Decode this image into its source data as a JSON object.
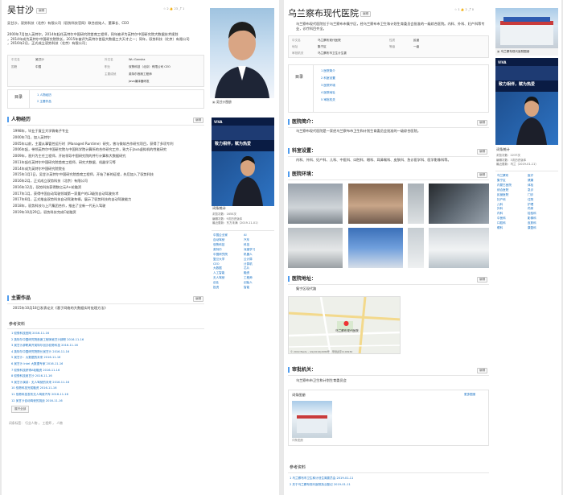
{
  "colors": {
    "link": "#136ec2",
    "accent": "#4f9cee",
    "banner": "#0a1c44",
    "hospital_blue": "#2e5bb0"
  },
  "left": {
    "title": "吴甘沙",
    "edit": "编辑",
    "stats": [
      "2",
      "23",
      "1"
    ],
    "summary": "吴甘沙，驭势科技（北京）有限公司（驭势科技官网）联合创始人、董事长、CEO",
    "intro_lines": [
      "2000年7月加入英特尔，2014年起任英特尔中国研究院首席工程师，同年被评为英特尔中国研究院大数据技术规划",
      "，2014年成为英特尔中国研究院院长，2015年被评为英特尔首届大数据三大天才之一；同年，驭势科技（北京）有限公司",
      "，2016年2月，正式成立驭势科技（北京）有限公司；"
    ],
    "basic_info": [
      [
        "中文名",
        "吴甘沙",
        "外文名",
        "Wu Gansha"
      ],
      [
        "国籍",
        "中国",
        "职业",
        "驭势科技（北京）有限公司 CEO"
      ],
      [
        "",
        "",
        "主要成就",
        "英特尔首席工程师"
      ],
      [
        "",
        "",
        "",
        "Java编译器研发"
      ]
    ],
    "toc_label": "目录",
    "toc": [
      "1 人物经历",
      "2 主要作品"
    ],
    "sec1": "人物经历",
    "bio": [
      "1998年，毕业于复旦大学微电子专业",
      "2000年7月，加入英特尔",
      "2005年以前，主要从事管控运行时（Managed Runtime）研究，曾与微软合作研究项目，获得了多项专利",
      "2006年起，带领英特尔中国研究院与中国科学院计算所的合作研究工作，致力于Java虚拟机的性能研究",
      "2009年，晋升为主任工程师，开始领导中国研究院的并行计算和大数据研究",
      "2011年起任英特尔中国研究院首席工程师，研究大数据、机器学习等",
      "2014年成为英特尔中国研究院院长",
      "2015年1月1日，吴甘沙英特尔中国研究院首席工程师，开始了新的征程，先后加入了驭势科技",
      "2016年2月，正式成立驭势科技（北京）有限公司",
      "2016年12月，驭势科技获得数亿元A+轮融资",
      "2017年1月，获得中国自动驾驶领域第一家量产的L3级别自动驾驶技术",
      "2017年8月，正式推出驭势科技自动驾驶车辆，展示了驭势科技的自动驾驶能力",
      "2018年，驭势科技与上汽集团合作，推出了全新一代无人驾驶",
      "2019年10月29日，驭势科技完成C轮融资"
    ],
    "sec2": "主要作品",
    "works": "2015年10月18日发表论文《基于网络的大数据实时处理方法》",
    "refs_title": "参考资料",
    "refs": [
      "1 驭势科技官网  2016-11-16",
      "2 英特尔中国研究院首席工程师吴甘沙辞职  2016-11-16",
      "3 吴甘沙辞职离开英特尔创办驭势科技  2016-11-16",
      "4 英特尔中国研究院院长吴甘沙  2016-11-16",
      "5 吴甘沙：大数据的未来  2016-11-16",
      "6 吴甘沙 Intel 大数据专家  2016-11-16",
      "7 驭势科技获得A轮融资  2016-11-16",
      "8 驭势科技吴甘沙  2016-11-16",
      "9 吴甘沙演讲：无人驾驶的未来  2016-11-16",
      "10 驭势科技完成融资  2016-11-16",
      "11 驭势科技发布无人驾驶汽车  2016-11-16",
      "12 吴甘沙自动驾驶的挑战  2016-11-16"
    ],
    "more_btn": "展开全部",
    "tags": "词条标签：  行业人物 ， 工程师 ， 人物",
    "photo_caption": "吴甘沙图册",
    "banner_brand": "VIVA",
    "banner_text": "致力相伴，赋为热爱",
    "stats_title": "词条统计",
    "stats_lines": [
      "浏览次数：1655次",
      "编辑次数：9次历史版本",
      "最近更新：东方未满（2019-11-01）"
    ],
    "links_col1": [
      "中国企业家",
      "自动驾驶",
      "驭势科技",
      "英特尔",
      "中国研究院",
      "复旦大学",
      "CEO",
      "大数据",
      "人工智能",
      "无人驾驶",
      "创业",
      "投资"
    ],
    "links_col2": [
      "AI",
      "汽车",
      "科技",
      "深度学习",
      "机器人",
      "云计算",
      "计算机",
      "芯片",
      "融资",
      "工程师",
      "创始人",
      "智能"
    ]
  },
  "right": {
    "title": "乌兰察布现代医院",
    "edit": "编辑",
    "stats": [
      "1",
      "2",
      "0"
    ],
    "summary": "乌兰察布现代医院位于乌兰察布市集宁区，经乌兰察布市卫生和计划生育委员会批准的一级综合医院。内科、外科、妇产科等专业，诊疗科目齐全。",
    "basic_info": [
      [
        "中文名",
        "乌兰察布现代医院",
        "性质",
        "民营"
      ],
      [
        "地址",
        "集宁区",
        "等级",
        "一级"
      ],
      [
        "审批机关",
        "乌兰察布市卫生计生委",
        "",
        ""
      ]
    ],
    "toc_label": "目录",
    "toc": [
      "1 医院简介",
      "2 科室设置",
      "3 医院环境",
      "4 医院地址",
      "5 审批机关"
    ],
    "s_intro": "医院简介：",
    "intro_text": "乌兰察布现代医院是一家经乌兰察布市卫生和计划生育委员会批准的一级综合医院。",
    "s_dept": "科室设置：",
    "dept_text": "内科、外科、妇产科、儿科、中医科、口腔科、眼科、耳鼻喉科、皮肤科、急诊医学科、医学影像科等。",
    "s_env": "医院环境：",
    "s_addr": "医院地址：",
    "addr_text": "集宁区现代路",
    "map_label": "乌兰察布现代医院",
    "map_copy": "© 2019 Baidu - GS(2016)2089号 - 甲测资字1100930",
    "s_auth": "审批机关：",
    "auth_text": "乌兰察布市卫生和计划生育委员会",
    "album_title": "词条图册",
    "album_more": "更多图册",
    "refs_title": "参考资料",
    "refs": [
      "1 乌兰察布市卫生和计划生育委员会  2019-01-11",
      "2 关于乌兰察布现代医院执业登记  2019-01-11"
    ],
    "photo_caption": "乌兰察布现代医院图册",
    "banner_brand": "VIVA",
    "banner_text": "致力相伴，赋为热爱",
    "stats_title": "词条统计",
    "stats_lines": [
      "浏览次数：2237次",
      "编辑次数：3次历史版本",
      "最近更新：乌兰（2019-01-11）"
    ],
    "links_col1": [
      "乌兰察布",
      "集宁区",
      "内蒙古医院",
      "综合医院",
      "民营医院",
      "妇产科",
      "儿科",
      "外科",
      "内科",
      "中医科",
      "口腔科",
      "眼科"
    ],
    "links_col2": [
      "医疗",
      "健康",
      "体检",
      "急诊",
      "门诊",
      "住院",
      "护理",
      "药房",
      "检验科",
      "影像科",
      "皮肤科",
      "康复科"
    ]
  }
}
